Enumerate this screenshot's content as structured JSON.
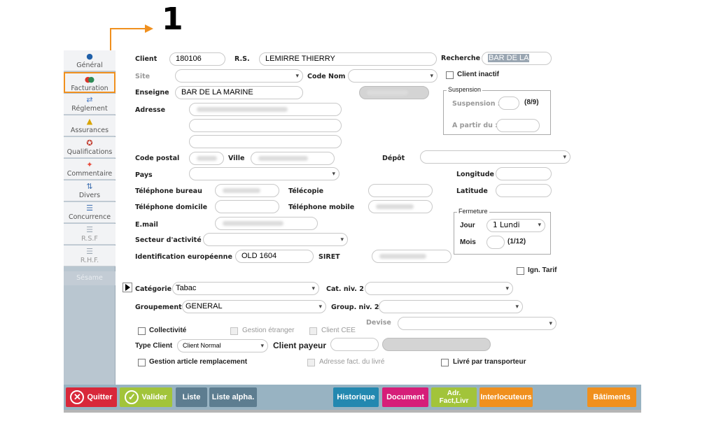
{
  "annotation": {
    "number": "1"
  },
  "sidebar": {
    "items": [
      {
        "label": "Général",
        "icon": "person-icon",
        "glyph": "👤",
        "color": "#1f5fa8"
      },
      {
        "label": "Facturation",
        "icon": "billing-icon",
        "glyph": "●",
        "color": "#d9342b"
      },
      {
        "label": "Réglement",
        "icon": "payment-icon",
        "glyph": "💱",
        "color": "#4a7bc4"
      },
      {
        "label": "Assurances",
        "icon": "bank-icon",
        "glyph": "🏛",
        "color": "#d9a400"
      },
      {
        "label": "Qualifications",
        "icon": "award-icon",
        "glyph": "🎖",
        "color": "#c0392b"
      },
      {
        "label": "Commentaire",
        "icon": "pin-icon",
        "glyph": "📌",
        "color": "#e74c3c"
      },
      {
        "label": "Divers",
        "icon": "misc-icon",
        "glyph": "⚙",
        "color": "#3d6fb0"
      },
      {
        "label": "Concurrence",
        "icon": "competition-icon",
        "glyph": "⚖",
        "color": "#3d6fb0"
      },
      {
        "label": "R.S.F",
        "icon": "list-icon",
        "glyph": "☰",
        "color": "#9aa6b2"
      },
      {
        "label": "R.H.F.",
        "icon": "list-icon",
        "glyph": "☰",
        "color": "#9aa6b2"
      }
    ],
    "sesame": "Sésame"
  },
  "form": {
    "client_label": "Client",
    "client_value": "180106",
    "rs_label": "R.S.",
    "rs_value": "LEMIRRE THIERRY",
    "recherche_label": "Recherche",
    "recherche_value": "BAR DE LA",
    "site_label": "Site",
    "code_nom_label": "Code Nom",
    "client_inactif_label": "Client inactif",
    "enseigne_label": "Enseigne",
    "enseigne_value": "BAR DE LA MARINE",
    "suspension_group": "Suspension",
    "suspension_label": "Suspension :",
    "suspension_count": "(8/9)",
    "a_partir_label": "A partir du :",
    "adresse_label": "Adresse",
    "code_postal_label": "Code postal",
    "ville_label": "Ville",
    "depot_label": "Dépôt",
    "pays_label": "Pays",
    "longitude_label": "Longitude",
    "tel_bureau_label": "Téléphone bureau",
    "telecopie_label": "Télécopie",
    "latitude_label": "Latitude",
    "tel_domicile_label": "Téléphone domicile",
    "tel_mobile_label": "Téléphone mobile",
    "fermeture_group": "Fermeture",
    "email_label": "E.mail",
    "jour_label": "Jour",
    "jour_value": "1  Lundi",
    "secteur_label": "Secteur d'activité",
    "mois_label": "Mois",
    "mois_count": "(1/12)",
    "ident_label": "Identification européenne",
    "ident_value": "OLD 1604",
    "siret_label": "SIRET",
    "ign_tarif_label": "Ign. Tarif",
    "categorie_label": "Catégorie",
    "categorie_value": "Tabac",
    "cat_niv2_label": "Cat. niv. 2",
    "groupement_label": "Groupement",
    "groupement_value": "GENERAL",
    "group_niv2_label": "Group. niv. 2",
    "devise_label": "Devise",
    "collectivite_label": "Collectivité",
    "gestion_etranger_label": "Gestion étranger",
    "client_cee_label": "Client CEE",
    "type_client_label": "Type Client",
    "type_client_value": "Client Normal",
    "client_payeur_label": "Client payeur",
    "gestion_article_label": "Gestion article remplacement",
    "adresse_fact_label": "Adresse fact. du livré",
    "livre_transporteur_label": "Livré par transporteur"
  },
  "buttons": {
    "quitter": "Quitter",
    "valider": "Valider",
    "liste": "Liste",
    "liste_alpha": "Liste alpha.",
    "historique": "Historique",
    "document": "Document",
    "adr_line1": "Adr.",
    "adr_line2": "Fact,Livr",
    "interlocuteurs": "Interlocuteurs",
    "batiments": "Bâtiments"
  },
  "colors": {
    "quitter": "#d8283a",
    "valider": "#a2c43a",
    "liste": "#5d7d90",
    "historique": "#2388b0",
    "document": "#d61e79",
    "adr": "#a2c43a",
    "orange": "#f0901e",
    "annotation": "#f0901e"
  }
}
